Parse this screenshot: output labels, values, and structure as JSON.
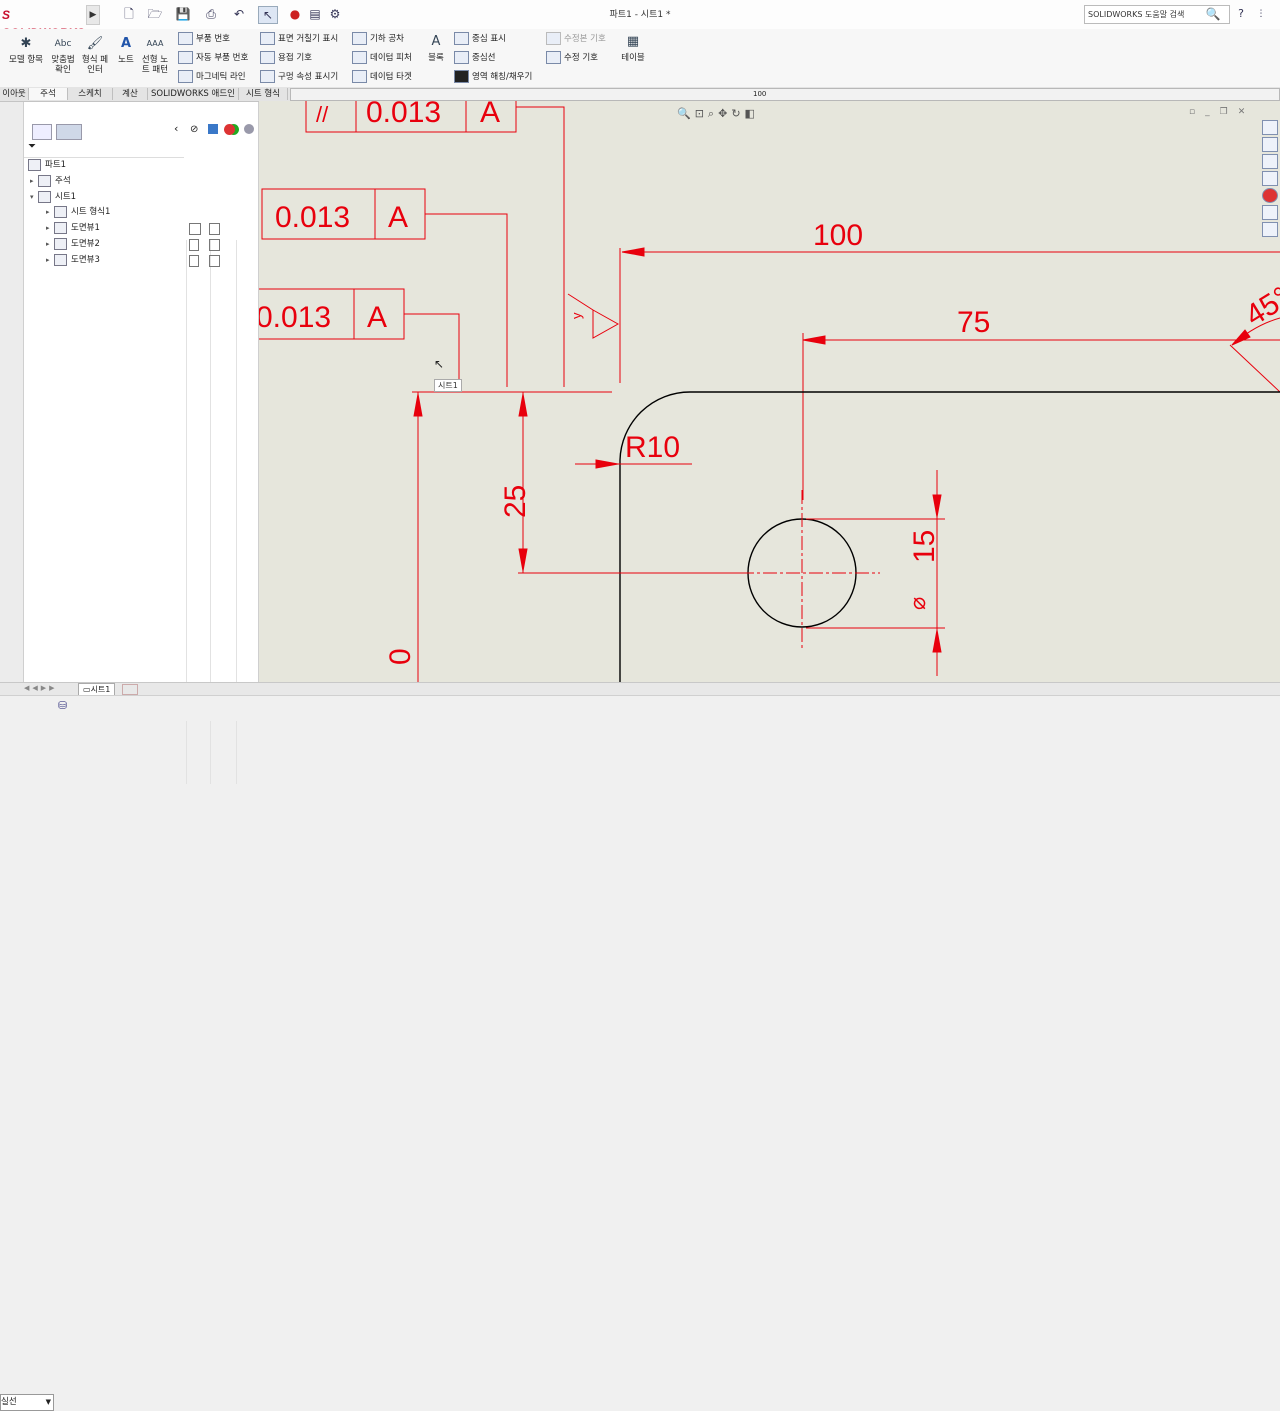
{
  "app": {
    "logo": "S SOLIDWORKS",
    "title": "파트1 - 시트1 *",
    "help_search": "SOLIDWORKS 도움말 검색",
    "help": "?"
  },
  "ribbon": {
    "big_buttons": [
      {
        "label": "모델 항목",
        "icon": "model-items-icon"
      },
      {
        "label": "맞춤법 확인",
        "icon": "spell-check-icon"
      },
      {
        "label": "형식 페인터",
        "icon": "format-painter-icon"
      },
      {
        "label": "노트",
        "icon": "note-icon"
      },
      {
        "label": "선형 노트 패턴",
        "icon": "linear-note-pattern-icon"
      }
    ],
    "col1": [
      "부품 번호",
      "자동 부품 번호",
      "마그네틱 라인"
    ],
    "col2": [
      "표면 거칠기 표시",
      "용접 기호",
      "구멍 속성 표시기"
    ],
    "col3": [
      "기하 공차",
      "데이텀 피처",
      "데이텀 타겟"
    ],
    "block": "블록",
    "col4": [
      "중심 표시",
      "중심선",
      "영역 해칭/채우기"
    ],
    "col5": [
      "수정본 기호",
      "수정 기호"
    ],
    "table": "테이블"
  },
  "tabs": [
    "이아웃",
    "주석",
    "스케치",
    "계산",
    "SOLIDWORKS 애드인",
    "시트 형식"
  ],
  "ruler_label": "100",
  "tree": {
    "root": "파트1",
    "items": [
      "주석",
      "시트1",
      "시트 형식1",
      "도면뷰1",
      "도면뷰2",
      "도면뷰3"
    ]
  },
  "sheet_tab": "시트1",
  "cursor_tooltip": "시트1",
  "layer": "실선",
  "drawing": {
    "tolerance_value": "0.013",
    "datum": "A",
    "parallel_symbol": "//",
    "dim_100": "100",
    "dim_75": "75",
    "dim_45": "45°",
    "dim_r10": "R10",
    "dim_25": "25",
    "dim_15": "15",
    "diameter_symbol": "⌀",
    "dim_partial": "0",
    "weld_letter": "y"
  },
  "colors": {
    "annotation": "#e8000d",
    "geometry": "#000000",
    "sheet_bg": "#e6e6dc",
    "brand": "#c8102e"
  }
}
